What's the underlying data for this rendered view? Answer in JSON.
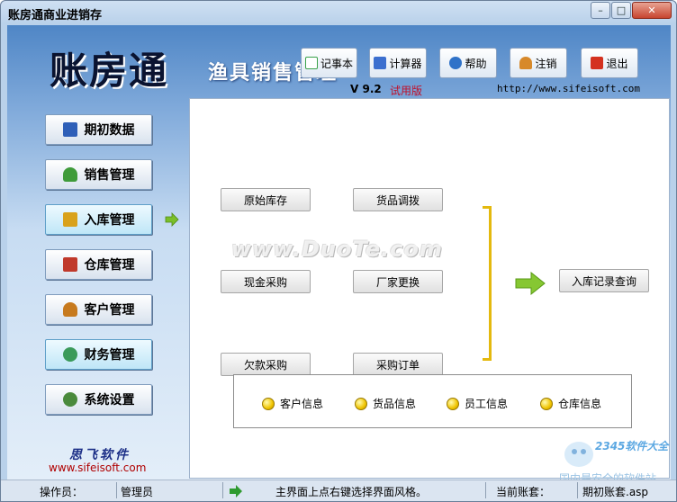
{
  "window": {
    "title": "账房通商业进销存",
    "controls": [
      "minimize-icon",
      "maximize-icon",
      "close-icon"
    ]
  },
  "header": {
    "logo": "账房通",
    "subtitle": "渔具销售管理",
    "version": "V 9.2",
    "trial": "试用版",
    "url": "http://www.sifeisoft.com"
  },
  "toolbar": [
    {
      "label": "记事本",
      "icon": "notepad-icon",
      "color": "#3aa24a"
    },
    {
      "label": "计算器",
      "icon": "calculator-icon",
      "color": "#3b6fcf"
    },
    {
      "label": "帮助",
      "icon": "help-icon",
      "color": "#2f72c8"
    },
    {
      "label": "注销",
      "icon": "users-icon",
      "color": "#d7892a"
    },
    {
      "label": "退出",
      "icon": "exit-icon",
      "color": "#d4311f"
    }
  ],
  "nav": [
    {
      "label": "期初数据",
      "icon": "book-icon",
      "color": "#2e5fb8"
    },
    {
      "label": "销售管理",
      "icon": "salesperson-icon",
      "color": "#3f9b3a"
    },
    {
      "label": "入库管理",
      "icon": "box-icon",
      "color": "#d9a21b",
      "active": true
    },
    {
      "label": "仓库管理",
      "icon": "warehouse-icon",
      "color": "#c0392b"
    },
    {
      "label": "客户管理",
      "icon": "customers-icon",
      "color": "#c77a1e"
    },
    {
      "label": "财务管理",
      "icon": "finance-icon",
      "color": "#3a9a5a",
      "active": true
    },
    {
      "label": "系统设置",
      "icon": "settings-gear-icon",
      "color": "#4a8a3c"
    }
  ],
  "functions": {
    "col1": [
      "原始库存",
      "现金采购",
      "欠款采购"
    ],
    "col2": [
      "货品调拨",
      "厂家更换",
      "采购订单"
    ],
    "query": "入库记录查询"
  },
  "info_links": [
    "客户信息",
    "货品信息",
    "员工信息",
    "仓库信息"
  ],
  "watermark": "www.DuoTe.com",
  "brand": {
    "name": "思飞软件",
    "url": "www.sifeisoft.com"
  },
  "corner": {
    "number": "2345软件大全",
    "site": "国内最安全的软件站"
  },
  "statusbar": {
    "operator_label": "操作员：",
    "operator": "管理员",
    "hint": "主界面上点右键选择界面风格。",
    "account_label": "当前账套：",
    "account": "期初账套.asp"
  },
  "colors": {
    "accent": "#e4b90e",
    "arrow": "#7bbf2a",
    "link": "#b00000"
  }
}
